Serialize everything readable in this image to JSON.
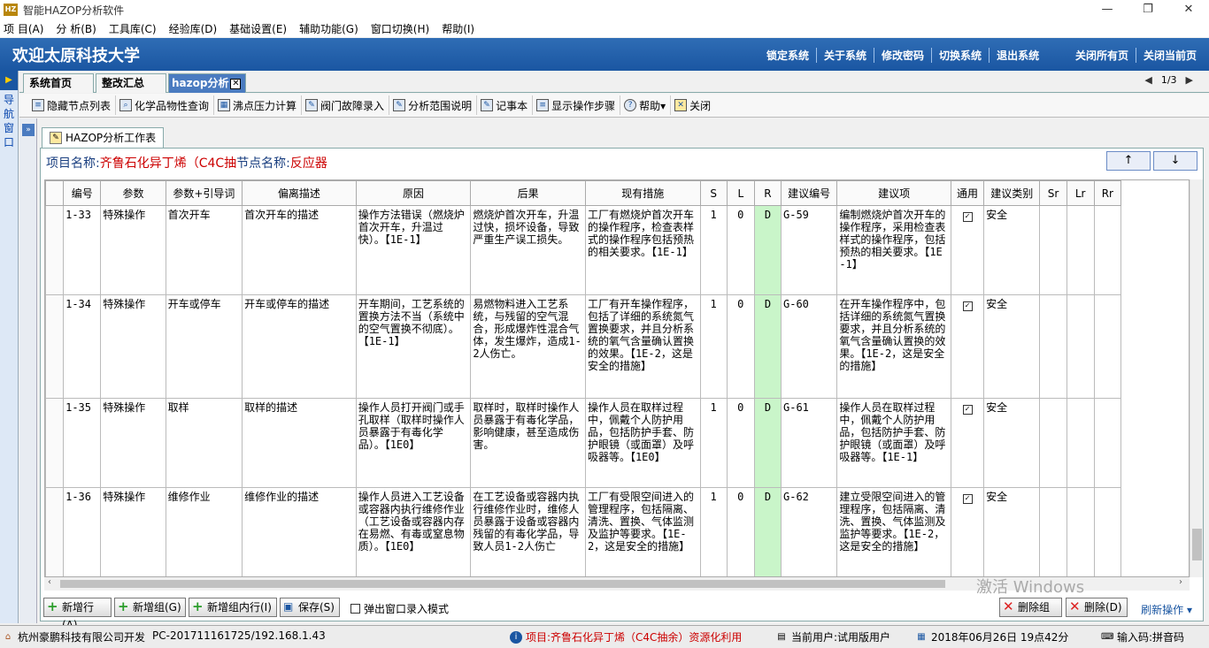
{
  "window": {
    "title": "智能HAZOP分析软件",
    "controls": [
      "—",
      "❐",
      "✕"
    ]
  },
  "menu": [
    "项 目(A)",
    "分 析(B)",
    "工具库(C)",
    "经验库(D)",
    "基础设置(E)",
    "辅助功能(G)",
    "窗口切换(H)",
    "帮助(I)"
  ],
  "banner": {
    "welcome": "欢迎太原科技大学",
    "links": [
      "锁定系统",
      "关于系统",
      "修改密码",
      "切换系统",
      "退出系统"
    ],
    "right_links": [
      "关闭所有页",
      "关闭当前页"
    ]
  },
  "nav": {
    "text": [
      "导",
      "航",
      "窗",
      "口"
    ]
  },
  "tabs": [
    {
      "label": "系统首页"
    },
    {
      "label": "整改汇总"
    },
    {
      "label": "hazop分析"
    }
  ],
  "pager": {
    "text": "1/3"
  },
  "toolbar": [
    {
      "label": "隐藏节点列表",
      "icon": "list-icon"
    },
    {
      "label": "化学品物性查询",
      "icon": "search-icon"
    },
    {
      "label": "沸点压力计算",
      "icon": "calculator-icon"
    },
    {
      "label": "阀门故障录入",
      "icon": "valve-icon"
    },
    {
      "label": "分析范围说明",
      "icon": "scope-icon"
    },
    {
      "label": "记事本",
      "icon": "notepad-icon"
    },
    {
      "label": "显示操作步骤",
      "icon": "steps-icon"
    },
    {
      "label": "帮助▾",
      "icon": "help-icon"
    },
    {
      "label": "关闭",
      "icon": "close-icon"
    }
  ],
  "worksheet_tab": {
    "label": "HAZOP分析工作表"
  },
  "project": {
    "name_label": "项目名称:",
    "name": "齐鲁石化异丁烯（C4C抽",
    "node_label": "节点名称:",
    "node": "反应器"
  },
  "sort_buttons": {
    "up": "↑",
    "down": "↓"
  },
  "table": {
    "headers": [
      "编号",
      "参数",
      "参数+引导词",
      "偏离描述",
      "原因",
      "后果",
      "现有措施",
      "S",
      "L",
      "R",
      "建议编号",
      "建议项",
      "通用",
      "建议类别",
      "Sr",
      "Lr",
      "Rr"
    ],
    "rows": [
      {
        "id": "1-33",
        "param": "特殊操作",
        "guide": "首次开车",
        "deviation": "首次开车的描述",
        "cause": "操作方法错误（燃烧炉首次开车，升温过快）。【1E-1】",
        "consequence": "燃烧炉首次开车，升温过快，损坏设备，导致严重生产误工损失。",
        "measures": "工厂有燃烧炉首次开车的操作程序，检查表样式的操作程序包括预热的相关要求。【1E-1】",
        "s": "1",
        "l": "0",
        "r": "D",
        "sug_id": "G-59",
        "suggestion": "编制燃烧炉首次开车的操作程序，采用检查表样式的操作程序，包括预热的相关要求。【1E-1】",
        "general": "✓",
        "category": "安全"
      },
      {
        "id": "1-34",
        "param": "特殊操作",
        "guide": "开车或停车",
        "deviation": "开车或停车的描述",
        "cause": "开车期间，工艺系统的置换方法不当（系统中的空气置换不彻底）。【1E-1】",
        "consequence": "易燃物料进入工艺系统，与残留的空气混合，形成爆炸性混合气体，发生爆炸，造成1-2人伤亡。",
        "measures": "工厂有开车操作程序，包括了详细的系统氮气置换要求，并且分析系统的氧气含量确认置换的效果。【1E-2，这是安全的措施】",
        "s": "1",
        "l": "0",
        "r": "D",
        "sug_id": "G-60",
        "suggestion": "在开车操作程序中，包括详细的系统氮气置换要求，并且分析系统的氧气含量确认置换的效果。【1E-2，这是安全的措施】",
        "general": "✓",
        "category": "安全"
      },
      {
        "id": "1-35",
        "param": "特殊操作",
        "guide": "取样",
        "deviation": "取样的描述",
        "cause": "操作人员打开阀门或手孔取样（取样时操作人员暴露于有毒化学品）。【1E0】",
        "consequence": "取样时，取样时操作人员暴露于有毒化学品，影响健康，甚至造成伤害。",
        "measures": "操作人员在取样过程中，佩戴个人防护用品，包括防护手套、防护眼镜（或面罩）及呼吸器等。【1E0】",
        "s": "1",
        "l": "0",
        "r": "D",
        "sug_id": "G-61",
        "suggestion": "操作人员在取样过程中，佩戴个人防护用品，包括防护手套、防护眼镜（或面罩）及呼吸器等。【1E-1】",
        "general": "✓",
        "category": "安全"
      },
      {
        "id": "1-36",
        "param": "特殊操作",
        "guide": "维修作业",
        "deviation": "维修作业的描述",
        "cause": "操作人员进入工艺设备或容器内执行维修作业（工艺设备或容器内存在易燃、有毒或窒息物质）。【1E0】",
        "consequence": "在工艺设备或容器内执行维修作业时，维修人员暴露于设备或容器内残留的有毒化学品，导致人员1-2人伤亡",
        "measures": "工厂有受限空间进入的管理程序，包括隔离、清洗、置换、气体监测及监护等要求。【1E-2，这是安全的措施】",
        "s": "1",
        "l": "0",
        "r": "D",
        "sug_id": "G-62",
        "suggestion": "建立受限空间进入的管理程序，包括隔离、清洗、置换、气体监测及监护等要求。【1E-2，这是安全的措施】",
        "general": "✓",
        "category": "安全"
      }
    ]
  },
  "bottom": {
    "buttons": [
      "新增行(A)",
      "新增组(G)",
      "新增组内行(I)",
      "保存(S)"
    ],
    "popup_mode": "弹出窗口录入模式",
    "delete_group": "删除组",
    "delete": "删除(D)",
    "refresh": "刷新操作"
  },
  "watermark": "激活 Windows",
  "status": {
    "company": "杭州豪鹏科技有限公司开发",
    "host": "PC-201711161725/192.168.1.43",
    "project": "项目:齐鲁石化异丁烯（C4C抽余）资源化利用",
    "user": "当前用户:试用版用户",
    "datetime": "2018年06月26日 19点42分",
    "input": "输入码:拼音码"
  }
}
